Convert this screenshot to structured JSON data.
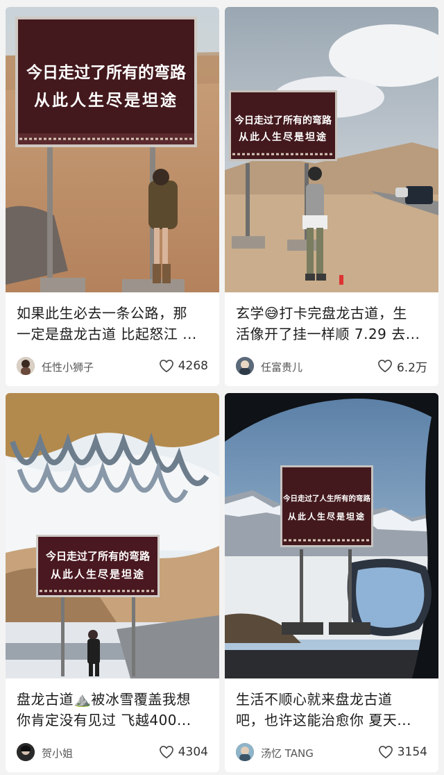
{
  "posts": [
    {
      "sign_line1": "今日走过了所有的弯路",
      "sign_line2": "从此人生尽是坦途",
      "title_line1": "如果此生必去一条公路，那",
      "title_line2": "一定是盘龙古道 比起怒江 ...",
      "author": "任性小狮子",
      "likes": "4268"
    },
    {
      "sign_line1": "今日走过了所有的弯路",
      "sign_line2": "从此人生尽是坦途",
      "title_line1": "玄学😅打卡完盘龙古道，生",
      "title_line2": "活像开了挂一样顺 7.29 去...",
      "author": "任富贵儿",
      "likes": "6.2万"
    },
    {
      "sign_line1": "今日走过了所有的弯路",
      "sign_line2": "从此人生尽是坦途",
      "title_line1": "盘龙古道⛰️被冰雪覆盖我想",
      "title_line2": "你肯定没有见过 飞越400...",
      "author": "贺小姐",
      "likes": "4304"
    },
    {
      "sign_line1": "今日走过了人生所有的弯路",
      "sign_line2": "从此人生尽是坦途",
      "title_line1": "生活不顺心就来盘龙古道",
      "title_line2": "吧，也许这能治愈你 夏天...",
      "author": "汤忆 TANG",
      "likes": "3154"
    }
  ],
  "icons": {
    "like": "heart-outline-icon"
  },
  "colors": {
    "background": "#f3f3f3",
    "card": "#ffffff",
    "sign": "#4a1f24",
    "heart": "#444444"
  }
}
